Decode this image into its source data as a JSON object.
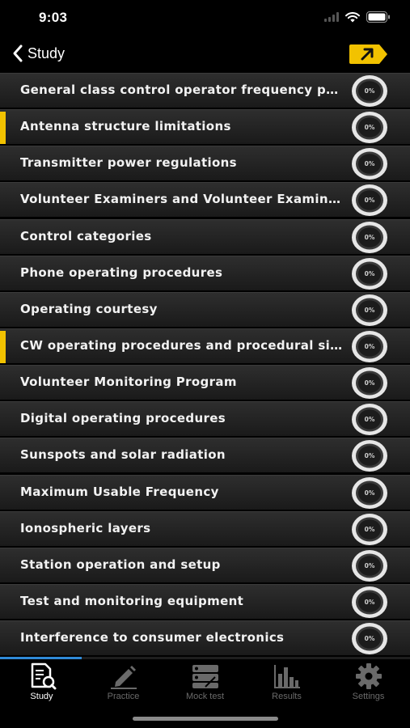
{
  "status_bar": {
    "time": "9:03"
  },
  "nav": {
    "back_label": "Study"
  },
  "topics": [
    {
      "label": "General class control operator frequency privil…",
      "progress": "0%",
      "marked": false
    },
    {
      "label": "Antenna structure limitations",
      "progress": "0%",
      "marked": true
    },
    {
      "label": "Transmitter power regulations",
      "progress": "0%",
      "marked": false
    },
    {
      "label": "Volunteer Examiners and Volunteer Examiner…",
      "progress": "0%",
      "marked": false
    },
    {
      "label": "Control categories",
      "progress": "0%",
      "marked": false
    },
    {
      "label": "Phone operating procedures",
      "progress": "0%",
      "marked": false
    },
    {
      "label": "Operating courtesy",
      "progress": "0%",
      "marked": false
    },
    {
      "label": "CW operating procedures and procedural sign…",
      "progress": "0%",
      "marked": true
    },
    {
      "label": "Volunteer Monitoring Program",
      "progress": "0%",
      "marked": false
    },
    {
      "label": "Digital operating procedures",
      "progress": "0%",
      "marked": false
    },
    {
      "label": "Sunspots and solar radiation",
      "progress": "0%",
      "marked": false
    },
    {
      "label": "Maximum Usable Frequency",
      "progress": "0%",
      "marked": false
    },
    {
      "label": "Ionospheric layers",
      "progress": "0%",
      "marked": false
    },
    {
      "label": "Station operation and setup",
      "progress": "0%",
      "marked": false
    },
    {
      "label": "Test and monitoring equipment",
      "progress": "0%",
      "marked": false
    },
    {
      "label": "Interference to consumer electronics",
      "progress": "0%",
      "marked": false
    }
  ],
  "scroll_progress_fraction": 0.2,
  "tabs": [
    {
      "label": "Study",
      "icon": "study-icon",
      "active": true
    },
    {
      "label": "Practice",
      "icon": "pencil-icon",
      "active": false
    },
    {
      "label": "Mock test",
      "icon": "mock-test-icon",
      "active": false
    },
    {
      "label": "Results",
      "icon": "bar-chart-icon",
      "active": false
    },
    {
      "label": "Settings",
      "icon": "gear-icon",
      "active": false
    }
  ],
  "colors": {
    "accent_yellow": "#f2c200",
    "progress_blue": "#2f8ad8",
    "inactive_tab": "#6a6a6a"
  }
}
